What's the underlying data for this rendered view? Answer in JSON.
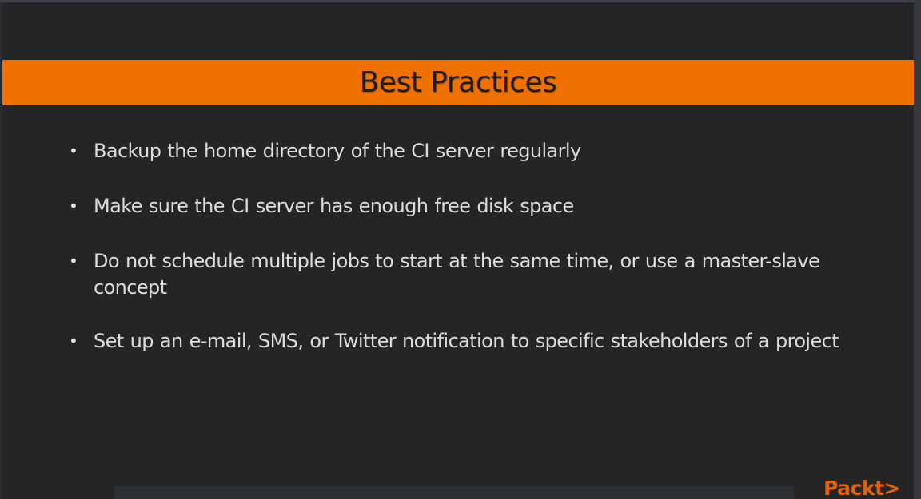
{
  "slide": {
    "title": "Best Practices",
    "bullets": [
      {
        "text": "Backup the home directory of the CI server regularly"
      },
      {
        "text": "Make sure the CI server has enough free disk space"
      },
      {
        "text": "Do not schedule multiple jobs to start at the same time, or use a master-slave concept"
      },
      {
        "text": "Set up an e-mail, SMS, or Twitter notification to specific stakeholders of a project"
      }
    ],
    "bullet_glyph": "•"
  },
  "branding": {
    "logo_text": "Packt>"
  },
  "colors": {
    "title_bar": "#ef7102",
    "background": "#252525",
    "body_text": "#dcdcdc",
    "logo": "#e0620a"
  }
}
